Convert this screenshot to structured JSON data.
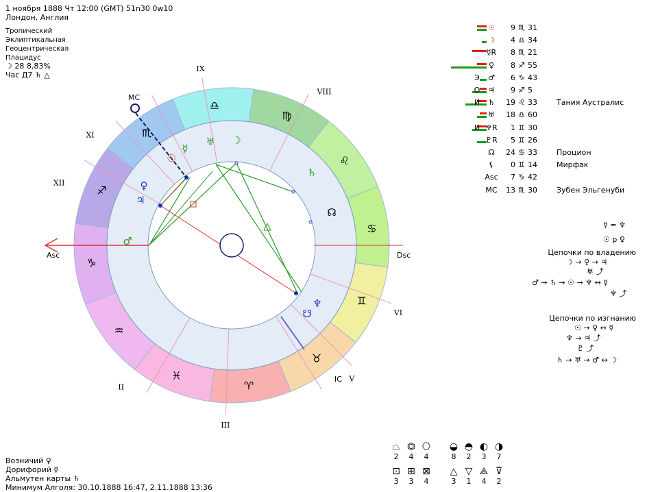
{
  "header": {
    "line1": "1 ноября 1888  Чт  12:00 (GMT) 51n30  0w10",
    "line2": "Лондон, Англия",
    "settings": [
      "Тропический",
      "Эклиптикальная",
      "Геоцентрическая",
      "Плацидус"
    ],
    "moon_phase": "☽  28 8,83%",
    "hour": "Час Д7 ♄ △"
  },
  "houses": [
    "IX",
    "VIII",
    "Dsc",
    "VI",
    "V",
    "IC",
    "III",
    "II",
    "Asc",
    "XII",
    "XI",
    "MC"
  ],
  "signs": [
    "♎",
    "♍",
    "♌",
    "♋",
    "♊",
    "♉",
    "♈",
    "♓",
    "♒",
    "♑",
    "♐",
    "♏"
  ],
  "sign_colors": [
    "#a0f0f0",
    "#a0d8a0",
    "#c0f0a0",
    "#c0f090",
    "#f0f0a0",
    "#f8d8a8",
    "#f8b0b0",
    "#f8b8e0",
    "#f0b8f0",
    "#e0b0f0",
    "#b8a8e8",
    "#a0c8f0"
  ],
  "chart_planets": [
    "☿",
    "♅",
    "☽",
    "♄",
    "☉",
    "♀",
    "♃",
    "♂",
    "♆",
    "☋",
    "☊"
  ],
  "positions": [
    {
      "aux": "",
      "glyph": "☉",
      "deg": "9",
      "sign": "♏",
      "mins": "31",
      "star": ""
    },
    {
      "aux": "",
      "glyph": "☽",
      "deg": "4",
      "sign": "♎",
      "mins": "34",
      "star": ""
    },
    {
      "aux": "",
      "glyph": "☿R",
      "deg": "8",
      "sign": "♏",
      "mins": "21",
      "star": ""
    },
    {
      "aux": "",
      "glyph": "♀",
      "deg": "8",
      "sign": "♐",
      "mins": "55",
      "star": ""
    },
    {
      "aux": "Э",
      "glyph": "♂",
      "deg": "6",
      "sign": "♑",
      "mins": "43",
      "star": ""
    },
    {
      "aux": "О",
      "glyph": "♃",
      "deg": "9",
      "sign": "♐",
      "mins": "5",
      "star": ""
    },
    {
      "aux": "И",
      "glyph": "♄",
      "deg": "19",
      "sign": "♌",
      "mins": "33",
      "star": "Тания Аустралис"
    },
    {
      "aux": "",
      "glyph": "♅",
      "deg": "18",
      "sign": "♎",
      "mins": "60",
      "star": ""
    },
    {
      "aux": "И",
      "glyph": "♆R",
      "deg": "1",
      "sign": "♊",
      "mins": "30",
      "star": ""
    },
    {
      "aux": "",
      "glyph": "♇R",
      "deg": "5",
      "sign": "♊",
      "mins": "26",
      "star": ""
    },
    {
      "aux": "",
      "glyph": "☊",
      "deg": "24",
      "sign": "♋",
      "mins": "33",
      "star": "Процион"
    },
    {
      "aux": "",
      "glyph": "⚸",
      "deg": "0",
      "sign": "♊",
      "mins": "14",
      "star": "Мирфак"
    },
    {
      "aux": "",
      "glyph": "Asc",
      "deg": "7",
      "sign": "♑",
      "mins": "42",
      "star": ""
    },
    {
      "aux": "",
      "glyph": "MC",
      "deg": "13",
      "sign": "♏",
      "mins": "30",
      "star": "Зубен Эльгенуби"
    }
  ],
  "bars": [
    {
      "green": 0.2,
      "red": 0.2
    },
    {
      "green": 0.1,
      "red": 0.0
    },
    {
      "green": 0.0,
      "red": 0.3
    },
    {
      "green": 0.75,
      "red": 0.2
    },
    {
      "green": 0.15,
      "red": 0.0
    },
    {
      "green": 0.3,
      "red": 0.15
    },
    {
      "green": 0.45,
      "red": 0.2
    },
    {
      "green": 0.2,
      "red": 0.15
    },
    {
      "green": 0.3,
      "red": 0.2
    },
    {
      "green": 0.2,
      "red": 0.0
    }
  ],
  "right_notes": {
    "eq": "☿ = ♆",
    "parallel": "☉ p ♀",
    "chain_title_1": "Цепочки по владению",
    "chain1_a": "☽ → ♀ → ♃",
    "chain1_b": "♅ ⤴",
    "chain1_c": "♂ → ♄ → ☉ → ♆ ↔ ☿",
    "chain1_d": "♆ ⤴",
    "chain_title_2": "Цепочки по изгнанию",
    "chain2_a": "☉ → ♀ ↔ ☿",
    "chain2_b": "♆ → ♃ ⤴",
    "chain2_c": "♇ ⤴",
    "chain2_d": "♄ → ♅ → ♂ ↔ ☽"
  },
  "footer": {
    "line1": "Возничий ♀",
    "line2": "Дорифорий ☿",
    "line3": "Альмутен карты ♄",
    "line4": "Минимум Алголя: 30.10.1888 16:47,  2.11.1888 13:36"
  },
  "stats": {
    "shapes_icons": [
      "⏢",
      "⏣",
      "⎔"
    ],
    "shapes_vals": [
      "2",
      "4",
      "4"
    ],
    "phases_icons": [
      "◒",
      "◓",
      "◐",
      "◑"
    ],
    "phases_vals": [
      "8",
      "2",
      "3",
      "7"
    ],
    "elements_icons": [
      "⊡",
      "⊞",
      "⊠"
    ],
    "elements_vals": [
      "3",
      "3",
      "4"
    ],
    "triangles_icons": [
      "△",
      "▽",
      "⟁",
      "⊽"
    ],
    "triangles_vals": [
      "3",
      "1",
      "4",
      "2"
    ]
  }
}
